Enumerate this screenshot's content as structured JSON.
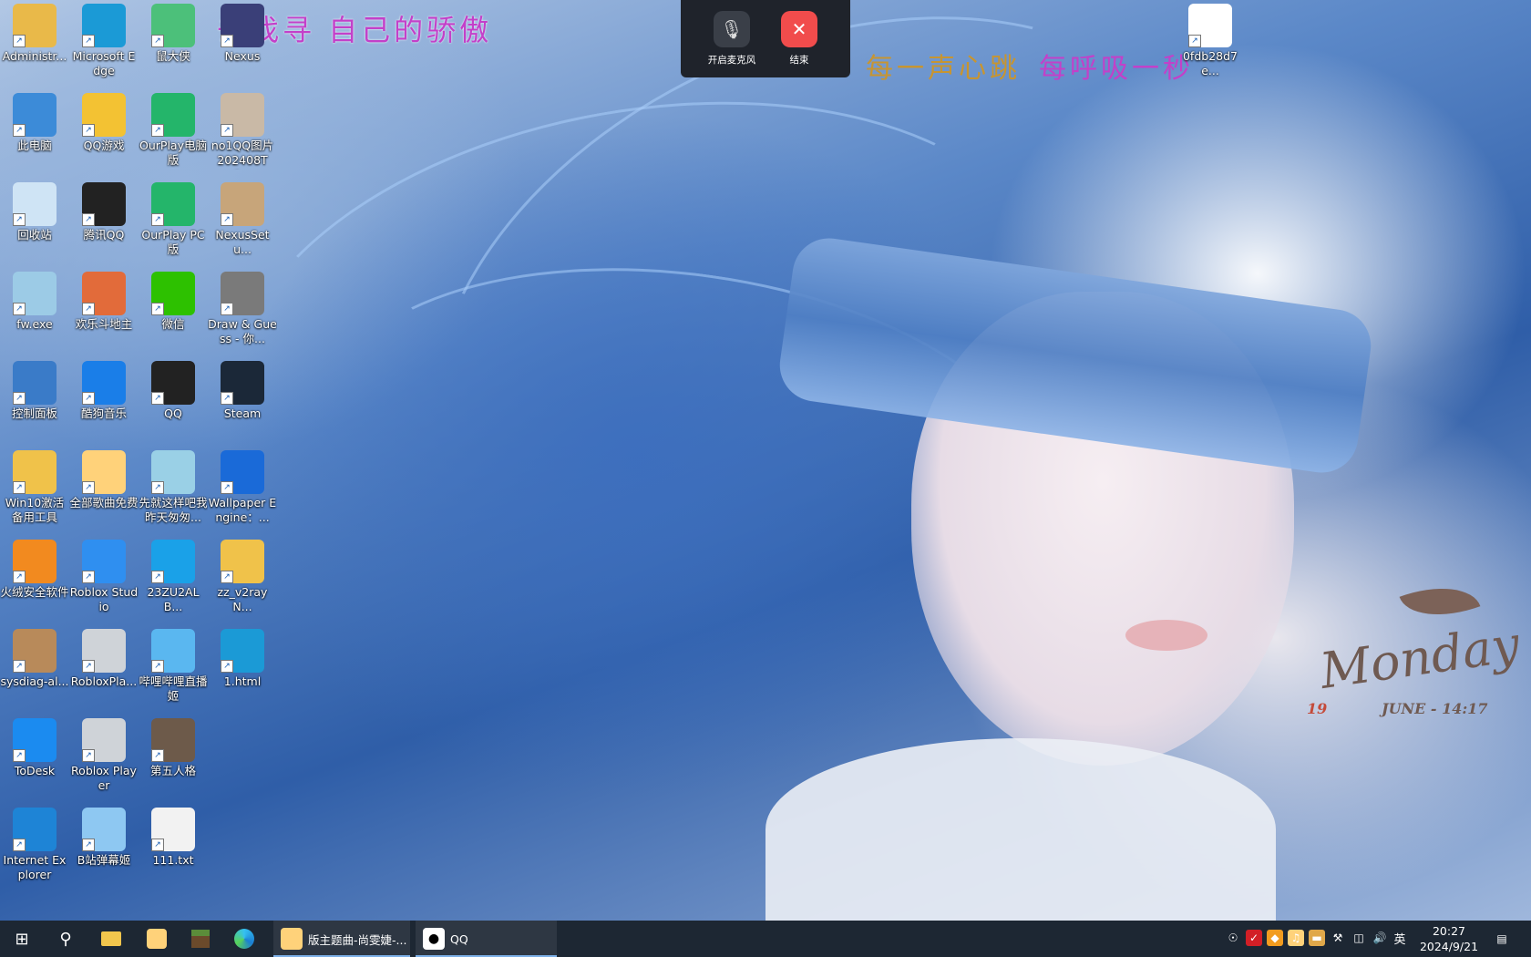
{
  "overlay": {
    "title": "去找寻  自己的骄傲",
    "lyric_a": "每一声心跳",
    "lyric_b": "每呼吸一秒"
  },
  "call_bar": {
    "mic_label": "开启麦克风",
    "end_label": "结束",
    "colors": {
      "background": "#1f232b",
      "end": "#f14c4c"
    }
  },
  "wallpaper_widget": {
    "day": "Monday",
    "date_num": "19",
    "month_time": "JUNE - 14:17"
  },
  "desktop_icons": [
    {
      "label": "Administr...",
      "icon": "user-folder-icon"
    },
    {
      "label": "此电脑",
      "icon": "computer-icon"
    },
    {
      "label": "回收站",
      "icon": "recycle-bin-icon"
    },
    {
      "label": "fw.exe",
      "icon": "whale-icon"
    },
    {
      "label": "控制面板",
      "icon": "control-panel-icon"
    },
    {
      "label": "Win10激活备用工具",
      "icon": "tool-folder-icon"
    },
    {
      "label": "火绒安全软件",
      "icon": "fire-shield-icon"
    },
    {
      "label": "sysdiag-al...",
      "icon": "installer-box-icon"
    },
    {
      "label": "ToDesk",
      "icon": "todesk-icon"
    },
    {
      "label": "Internet Explorer",
      "icon": "ie-icon"
    },
    {
      "label": "Microsoft Edge",
      "icon": "edge-icon"
    },
    {
      "label": "QQ游戏",
      "icon": "qq-game-icon"
    },
    {
      "label": "腾讯QQ",
      "icon": "qq-penguin-icon"
    },
    {
      "label": "欢乐斗地主",
      "icon": "doudizhu-icon"
    },
    {
      "label": "酷狗音乐",
      "icon": "kugou-icon"
    },
    {
      "label": "全部歌曲免费",
      "icon": "music-box-icon"
    },
    {
      "label": "Roblox Studio",
      "icon": "roblox-studio-icon"
    },
    {
      "label": "RobloxPla...",
      "icon": "roblox-icon"
    },
    {
      "label": "Roblox Player",
      "icon": "roblox-icon"
    },
    {
      "label": "B站弹幕姬",
      "icon": "bilibili-girl-icon"
    },
    {
      "label": "鼠大侠",
      "icon": "mouse-hero-icon"
    },
    {
      "label": "OurPlay电脑版",
      "icon": "ourplay-icon"
    },
    {
      "label": "OurPlay PC版",
      "icon": "ourplay-icon"
    },
    {
      "label": "微信",
      "icon": "wechat-icon"
    },
    {
      "label": "QQ",
      "icon": "qq-penguin-icon"
    },
    {
      "label": "先就这样吧我昨天匆匆...",
      "icon": "notepad-icon"
    },
    {
      "label": "23ZU2ALB...",
      "icon": "blue-image-icon"
    },
    {
      "label": "哔哩哔哩直播姬",
      "icon": "bilibili-live-icon"
    },
    {
      "label": "第五人格",
      "icon": "identity-v-icon"
    },
    {
      "label": "111.txt",
      "icon": "text-file-icon"
    },
    {
      "label": "Nexus",
      "icon": "nexus-icon"
    },
    {
      "label": "no1QQ图片202408TO...",
      "icon": "image-file-icon"
    },
    {
      "label": "NexusSetu...",
      "icon": "nexus-setup-icon"
    },
    {
      "label": "Draw & Guess - 你...",
      "icon": "pencil-icon"
    },
    {
      "label": "Steam",
      "icon": "steam-icon"
    },
    {
      "label": "Wallpaper Engine：...",
      "icon": "wallpaper-engine-icon"
    },
    {
      "label": "zz_v2rayN...",
      "icon": "zip-folder-icon"
    },
    {
      "label": "1.html",
      "icon": "edge-icon"
    },
    {
      "label": "0fdb28d7e...",
      "icon": "qr-image-icon"
    }
  ],
  "taskbar": {
    "apps": [
      {
        "label": "版主题曲-尚雯婕-...",
        "icon": "music-box-icon"
      },
      {
        "label": "QQ",
        "icon": "qq-penguin-icon"
      }
    ],
    "ime": "英",
    "time": "20:27",
    "date": "2024/9/21"
  }
}
